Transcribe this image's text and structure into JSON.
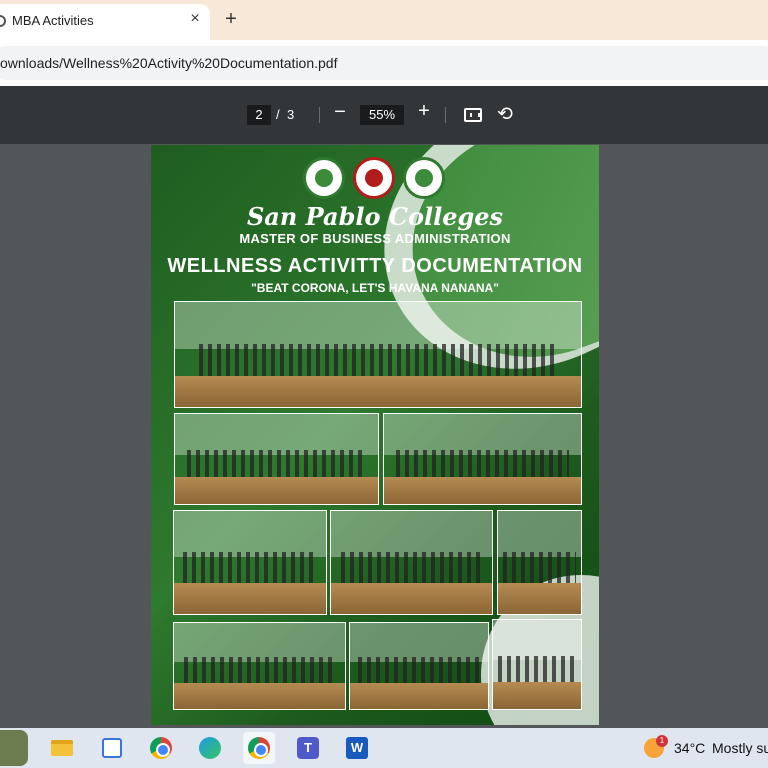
{
  "browser": {
    "tab_title": "MBA Activities",
    "tab_close": "×",
    "new_tab": "+",
    "url": "ownloads/Wellness%20Activity%20Documentation.pdf"
  },
  "pdf_toolbar": {
    "current_page": "2",
    "separator": "/",
    "total_pages": "3",
    "zoom_out": "−",
    "zoom": "55%",
    "zoom_in": "+",
    "fit_icon": "fit-page-icon",
    "rotate": "⟲"
  },
  "document": {
    "school": "San Pablo Colleges",
    "program": "MASTER OF BUSINESS ADMINISTRATION",
    "title": "WELLNESS ACTIVITTY DOCUMENTATION",
    "subtitle": "\"BEAT CORONA, LET'S HAVANA NANANA\"",
    "logos": [
      "college-seal-icon",
      "mba-seal-icon",
      "school-of-business-seal-icon"
    ],
    "photos": 9
  },
  "taskbar": {
    "apps": [
      "file-explorer-icon",
      "microsoft-store-icon",
      "chrome-icon",
      "edge-icon",
      "chrome-profile-icon",
      "teams-icon",
      "word-icon"
    ],
    "teams_label": "T",
    "word_label": "W",
    "weather_badge": "1",
    "temperature": "34°C",
    "weather": "Mostly su"
  },
  "colors": {
    "tabstrip": "#f8e8d8",
    "pdf_toolbar": "#323639",
    "viewer_bg": "#525659",
    "page_green": "#2e7a2e"
  }
}
